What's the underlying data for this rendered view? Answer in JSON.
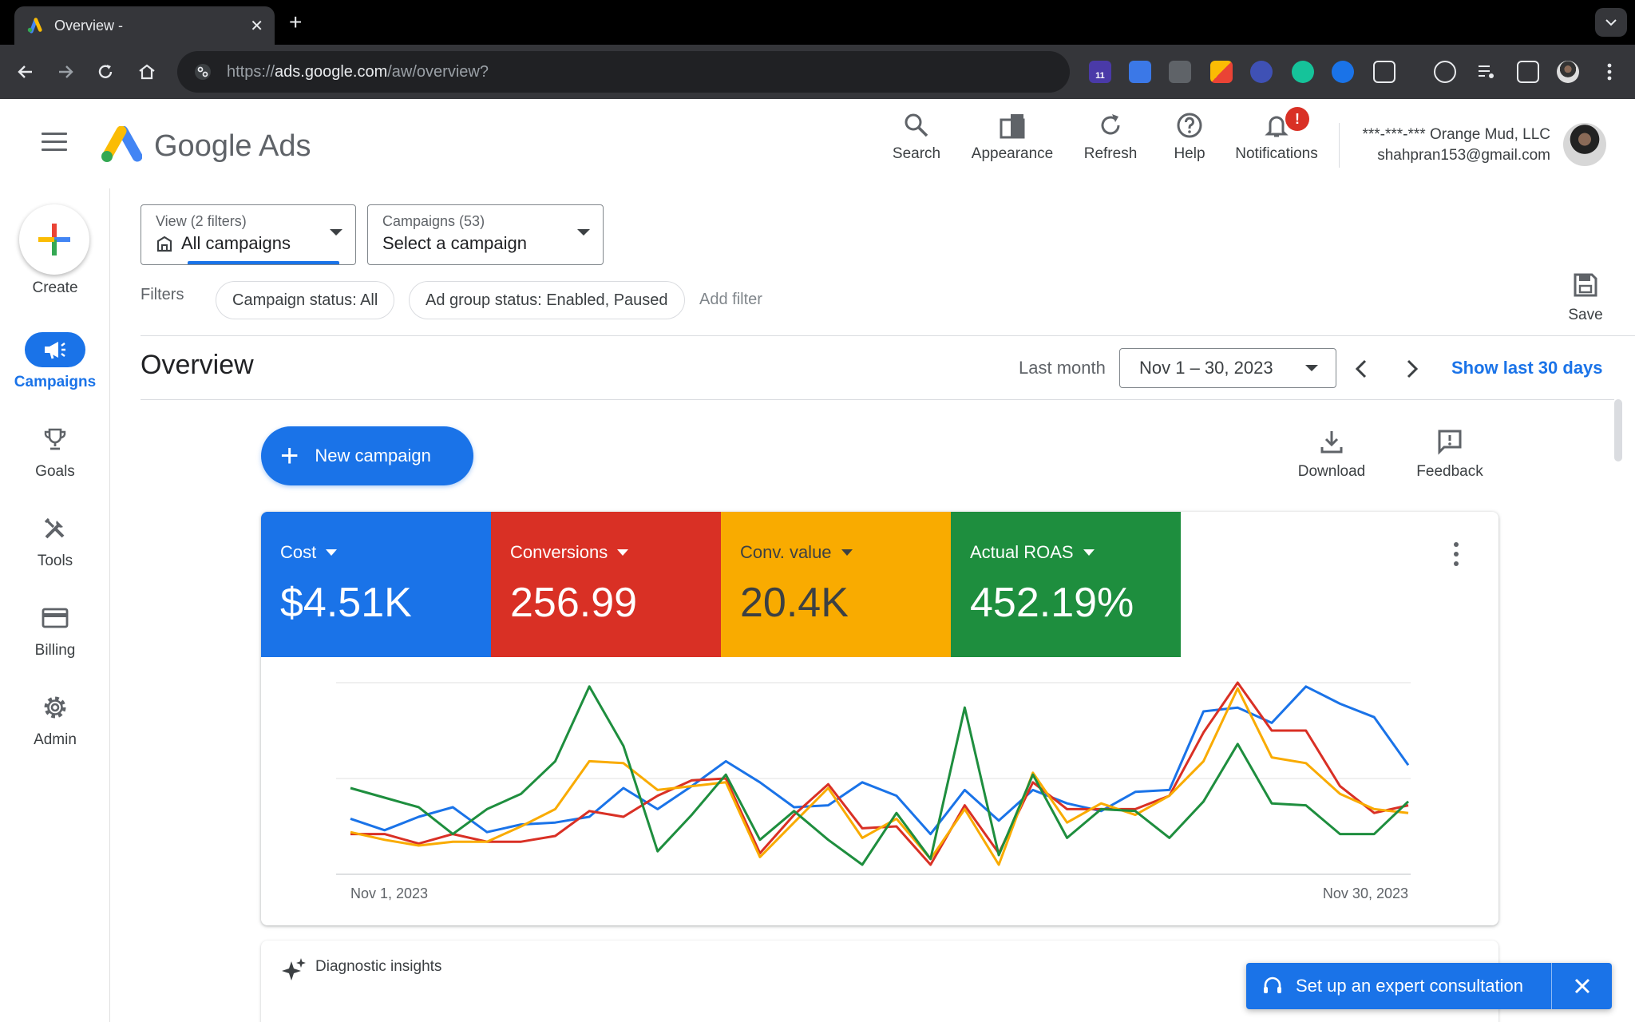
{
  "browser": {
    "tab_title": "Overview -",
    "tab_close": "✕",
    "new_tab": "+",
    "url_prefix": "https://",
    "url_host": "ads.google.com",
    "url_path": "/aw/overview?",
    "ext_badge": "11"
  },
  "header": {
    "brand": "Google Ads",
    "actions": [
      {
        "label": "Search",
        "icon": "search-icon"
      },
      {
        "label": "Appearance",
        "icon": "appearance-icon"
      },
      {
        "label": "Refresh",
        "icon": "refresh-icon"
      },
      {
        "label": "Help",
        "icon": "help-icon"
      },
      {
        "label": "Notifications",
        "icon": "bell-icon",
        "badge": "!"
      }
    ],
    "account_name": "***-***-*** Orange Mud, LLC",
    "account_email": "shahpran153@gmail.com"
  },
  "leftnav": {
    "create_label": "Create",
    "items": [
      {
        "label": "Campaigns",
        "icon": "megaphone-icon",
        "active": true
      },
      {
        "label": "Goals",
        "icon": "trophy-icon"
      },
      {
        "label": "Tools",
        "icon": "tools-icon"
      },
      {
        "label": "Billing",
        "icon": "credit-card-icon"
      },
      {
        "label": "Admin",
        "icon": "gear-icon"
      }
    ]
  },
  "view_filter": {
    "small": "View (2 filters)",
    "value": "All campaigns"
  },
  "campaign_filter": {
    "small": "Campaigns (53)",
    "value": "Select a campaign"
  },
  "filters": {
    "label": "Filters",
    "chips": [
      "Campaign status: All",
      "Ad group status: Enabled, Paused"
    ],
    "add_filter": "Add filter",
    "save_label": "Save"
  },
  "overview": {
    "title": "Overview",
    "period_label": "Last month",
    "date_range": "Nov 1 – 30, 2023",
    "show_last": "Show last 30 days",
    "new_campaign": "New campaign",
    "download": "Download",
    "feedback": "Feedback"
  },
  "metrics": [
    {
      "label": "Cost",
      "value": "$4.51K",
      "color": "#1a73e8"
    },
    {
      "label": "Conversions",
      "value": "256.99",
      "color": "#d93025"
    },
    {
      "label": "Conv. value",
      "value": "20.4K",
      "color": "#f9ab00"
    },
    {
      "label": "Actual ROAS",
      "value": "452.19%",
      "color": "#1e8e3e"
    }
  ],
  "chart_data": {
    "type": "line",
    "x_start_label": "Nov 1, 2023",
    "x_end_label": "Nov 30, 2023",
    "grid": true,
    "ylim": [
      0,
      1
    ],
    "series": [
      {
        "name": "Cost",
        "color": "#1a73e8",
        "values": [
          0.29,
          0.23,
          0.3,
          0.35,
          0.22,
          0.26,
          0.27,
          0.3,
          0.45,
          0.34,
          0.46,
          0.59,
          0.48,
          0.35,
          0.36,
          0.48,
          0.41,
          0.21,
          0.44,
          0.28,
          0.44,
          0.37,
          0.33,
          0.43,
          0.44,
          0.85,
          0.87,
          0.79,
          0.98,
          0.89,
          0.82,
          0.57
        ]
      },
      {
        "name": "Conversions",
        "color": "#d93025",
        "values": [
          0.21,
          0.21,
          0.16,
          0.21,
          0.17,
          0.17,
          0.2,
          0.33,
          0.3,
          0.41,
          0.49,
          0.5,
          0.11,
          0.31,
          0.47,
          0.24,
          0.25,
          0.05,
          0.36,
          0.11,
          0.48,
          0.34,
          0.34,
          0.34,
          0.41,
          0.74,
          1.0,
          0.75,
          0.75,
          0.46,
          0.32,
          0.36
        ]
      },
      {
        "name": "Conv. value",
        "color": "#f9ab00",
        "values": [
          0.22,
          0.18,
          0.15,
          0.17,
          0.17,
          0.25,
          0.34,
          0.59,
          0.58,
          0.44,
          0.46,
          0.48,
          0.09,
          0.27,
          0.45,
          0.19,
          0.29,
          0.08,
          0.34,
          0.05,
          0.53,
          0.27,
          0.37,
          0.31,
          0.41,
          0.59,
          0.97,
          0.61,
          0.58,
          0.42,
          0.34,
          0.32
        ]
      },
      {
        "name": "Actual ROAS",
        "color": "#1e8e3e",
        "values": [
          0.45,
          0.4,
          0.35,
          0.21,
          0.34,
          0.42,
          0.59,
          0.98,
          0.67,
          0.12,
          0.31,
          0.52,
          0.18,
          0.33,
          0.18,
          0.05,
          0.32,
          0.08,
          0.87,
          0.1,
          0.52,
          0.19,
          0.34,
          0.33,
          0.19,
          0.38,
          0.68,
          0.37,
          0.36,
          0.21,
          0.21,
          0.38
        ]
      }
    ]
  },
  "insights": {
    "label": "Diagnostic insights"
  },
  "toast": {
    "label": "Set up an expert consultation"
  }
}
